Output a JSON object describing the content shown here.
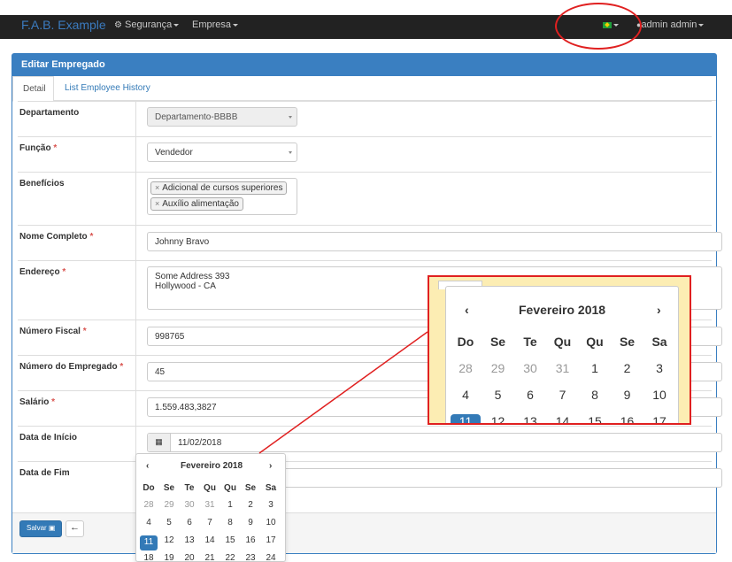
{
  "navbar": {
    "brand": "F.A.B. Example",
    "menu_security": "Segurança",
    "menu_company": "Empresa",
    "user": "admin admin",
    "flag_icon": "brazil-flag-icon"
  },
  "panel": {
    "title": "Editar Empregado",
    "tabs": [
      {
        "label": "Detail"
      },
      {
        "label": "List Employee History"
      }
    ]
  },
  "form": {
    "department": {
      "label": "Departamento",
      "value": "Departamento-BBBB"
    },
    "function": {
      "label": "Função",
      "value": "Vendedor"
    },
    "benefits": {
      "label": "Benefícios",
      "tags": [
        "Adicional de cursos superiores",
        "Auxílio alimentação"
      ]
    },
    "full_name": {
      "label": "Nome Completo",
      "value": "Johnny Bravo"
    },
    "address": {
      "label": "Endereço",
      "line1": "Some Address 393",
      "line2": "Hollywood - CA"
    },
    "tax_number": {
      "label": "Número Fiscal",
      "value": "998765"
    },
    "employee_number": {
      "label": "Número do Empregado",
      "value": "45"
    },
    "salary": {
      "label": "Salário",
      "value": "1.559.483,3827"
    },
    "start_date": {
      "label": "Data de Início",
      "value": "11/02/2018"
    },
    "end_date": {
      "label": "Data de Fim",
      "value": ""
    },
    "required_marker": "*"
  },
  "footer": {
    "save_label": "Salvar",
    "back_icon": "arrow-left-icon"
  },
  "datepicker": {
    "month_title": "Fevereiro 2018",
    "prev": "‹",
    "next": "›",
    "weekdays": [
      "Do",
      "Se",
      "Te",
      "Qu",
      "Qu",
      "Se",
      "Sa"
    ],
    "weeks": [
      [
        "28",
        "29",
        "30",
        "31",
        "1",
        "2",
        "3"
      ],
      [
        "4",
        "5",
        "6",
        "7",
        "8",
        "9",
        "10"
      ],
      [
        "11",
        "12",
        "13",
        "14",
        "15",
        "16",
        "17"
      ],
      [
        "18",
        "19",
        "20",
        "21",
        "22",
        "23",
        "24"
      ]
    ],
    "active_day": "11",
    "accent": "#337ab7"
  },
  "colors": {
    "navbar": "#222222",
    "primary": "#3a7fc1",
    "annotation": "#e02020",
    "zoom_background": "#fcedb3"
  }
}
